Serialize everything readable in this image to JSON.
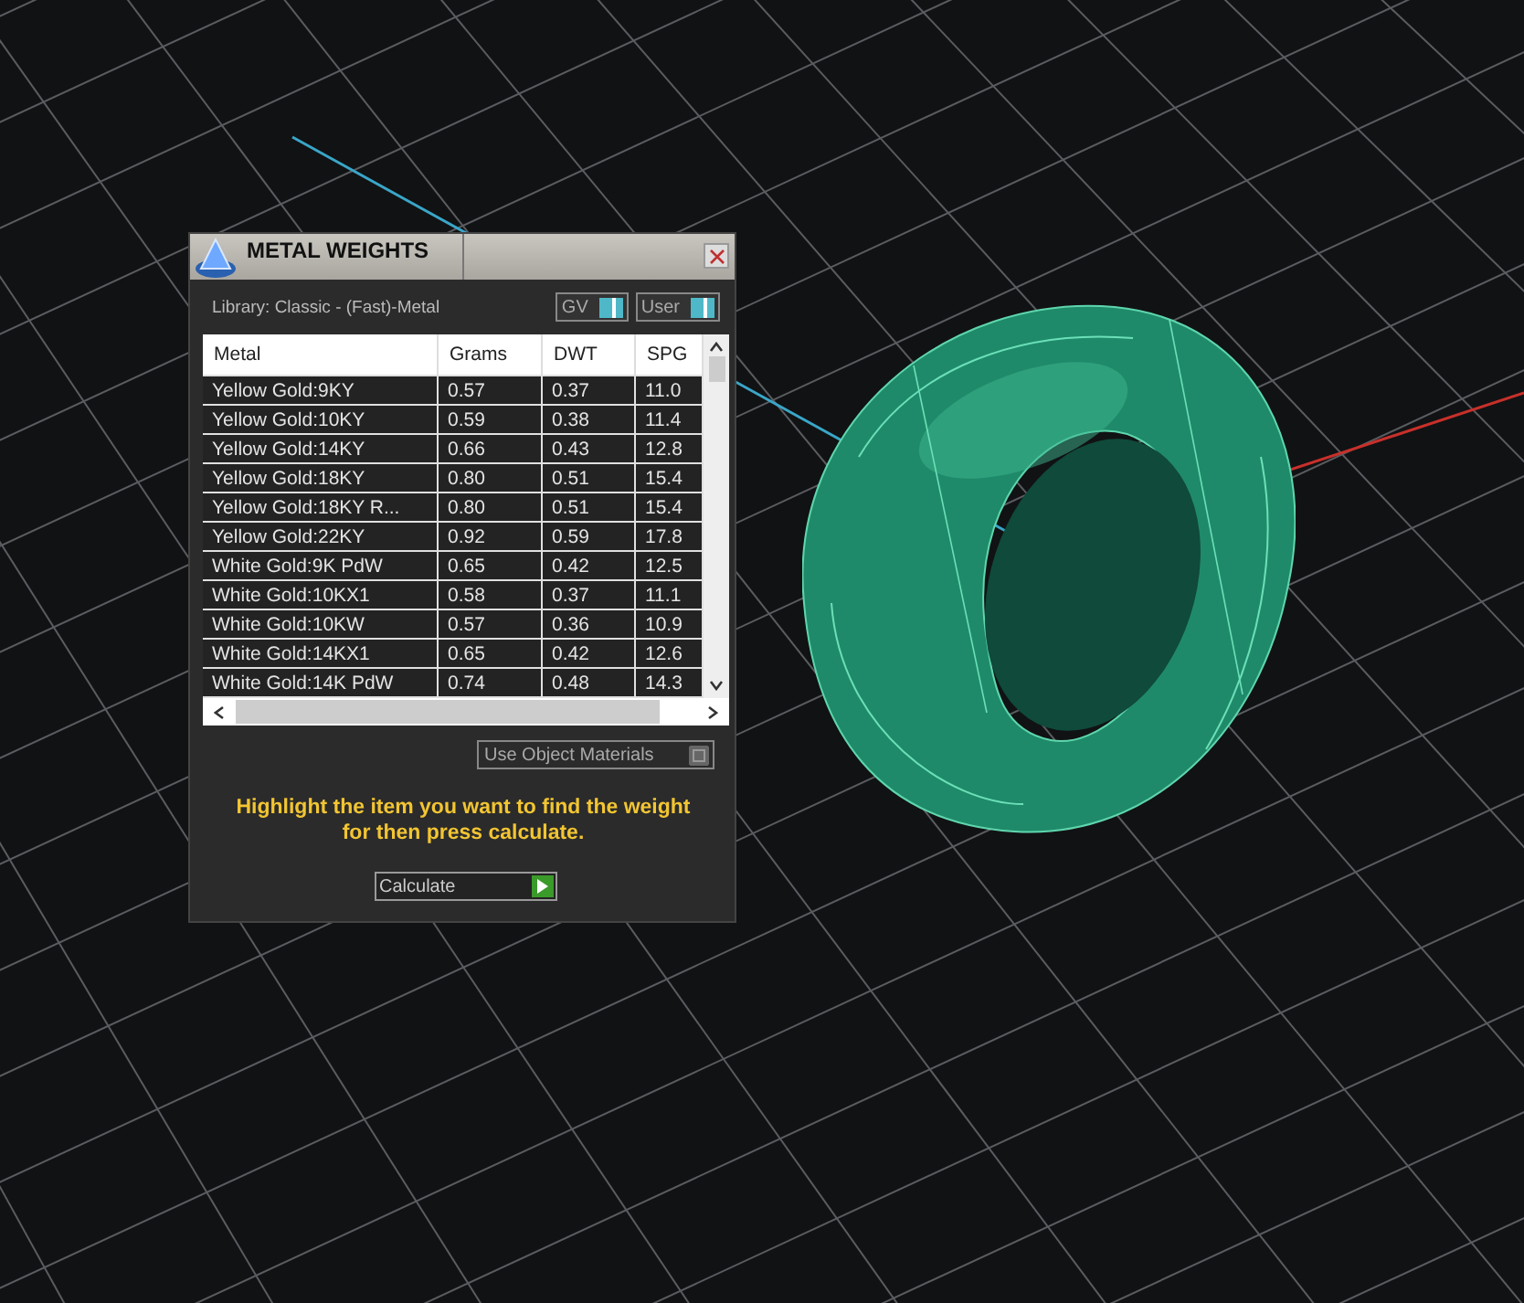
{
  "dialog": {
    "title": "METAL WEIGHTS",
    "library": "Library: Classic - (Fast)-Metal",
    "toggles": [
      {
        "label": "GV",
        "on": true
      },
      {
        "label": "User",
        "on": true
      }
    ],
    "table": {
      "columns": [
        "Metal",
        "Grams",
        "DWT",
        "SPG"
      ],
      "rows": [
        [
          "Yellow Gold:9KY",
          "0.57",
          "0.37",
          "11.0"
        ],
        [
          "Yellow Gold:10KY",
          "0.59",
          "0.38",
          "11.4"
        ],
        [
          "Yellow Gold:14KY",
          "0.66",
          "0.43",
          "12.8"
        ],
        [
          "Yellow Gold:18KY",
          "0.80",
          "0.51",
          "15.4"
        ],
        [
          "Yellow Gold:18KY R...",
          "0.80",
          "0.51",
          "15.4"
        ],
        [
          "Yellow Gold:22KY",
          "0.92",
          "0.59",
          "17.8"
        ],
        [
          "White Gold:9K PdW",
          "0.65",
          "0.42",
          "12.5"
        ],
        [
          "White Gold:10KX1",
          "0.58",
          "0.37",
          "11.1"
        ],
        [
          "White Gold:10KW",
          "0.57",
          "0.36",
          "10.9"
        ],
        [
          "White Gold:14KX1",
          "0.65",
          "0.42",
          "12.6"
        ],
        [
          "White Gold:14K PdW",
          "0.74",
          "0.48",
          "14.3"
        ]
      ]
    },
    "object_materials": {
      "label": "Use Object Materials",
      "on": false
    },
    "hint": "Highlight the item you want to find the weight for then press calculate.",
    "calculate_button": "Calculate"
  }
}
